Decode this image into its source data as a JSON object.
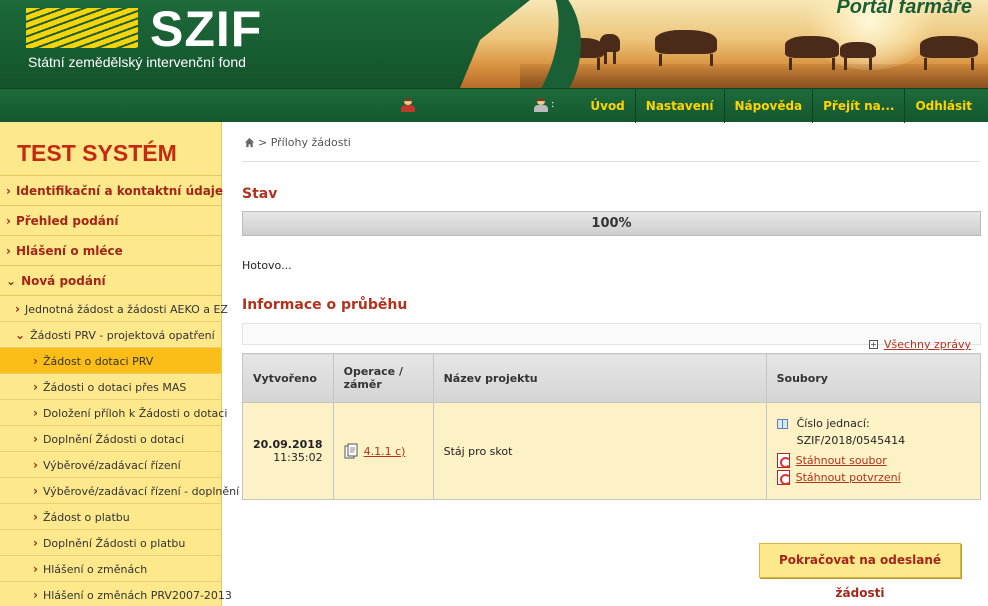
{
  "header": {
    "logo_text": "SZIF",
    "logo_subtitle": "Státní zemědělský intervenční fond",
    "portal_title": "Portál farmáře"
  },
  "nav": {
    "links": [
      "Úvod",
      "Nastavení",
      "Nápověda",
      "Přejít na...",
      "Odhlásit"
    ],
    "user_suffix": ":"
  },
  "sidebar": {
    "title": "TEST SYSTÉM",
    "items": [
      {
        "label": "Identifikační a kontaktní údaje",
        "level": 0
      },
      {
        "label": "Přehled podání",
        "level": 0
      },
      {
        "label": "Hlášení o mléce",
        "level": 0
      },
      {
        "label": "Nová podání",
        "level": 0,
        "expanded": true
      },
      {
        "label": "Jednotná žádost a žádosti AEKO a EZ",
        "level": 1
      },
      {
        "label": "Žádosti PRV - projektová opatření",
        "level": 1,
        "expanded": true
      },
      {
        "label": "Žádost o dotaci PRV",
        "level": 2,
        "active": true
      },
      {
        "label": "Žádosti o dotaci přes MAS",
        "level": 2
      },
      {
        "label": "Doložení příloh k Žádosti o dotaci",
        "level": 2
      },
      {
        "label": "Doplnění Žádosti o dotaci",
        "level": 2
      },
      {
        "label": "Výběrové/zadávací řízení",
        "level": 2
      },
      {
        "label": "Výběrové/zadávací řízení - doplnění",
        "level": 2
      },
      {
        "label": "Žádost o platbu",
        "level": 2
      },
      {
        "label": "Doplnění Žádosti o platbu",
        "level": 2
      },
      {
        "label": "Hlášení o změnách",
        "level": 2
      },
      {
        "label": "Hlášení o změnách PRV2007-2013",
        "level": 2
      }
    ]
  },
  "main": {
    "breadcrumb": "> Přílohy žádosti",
    "status_heading": "Stav",
    "progress_percent": 100,
    "progress_label": "100%",
    "status_text": "Hotovo...",
    "info_heading": "Informace o průběhu",
    "all_messages": "Všechny zprávy",
    "table": {
      "headers": [
        "Vytvořeno",
        "Operace / záměr",
        "Název projektu",
        "Soubory"
      ],
      "row": {
        "date": "20.09.2018",
        "time": "11:35:02",
        "operation": "4.1.1 c)",
        "project_name": "Stáj pro skot",
        "ref_label": "Číslo jednací:",
        "ref_number": "SZIF/2018/0545414",
        "download_file": "Stáhnout soubor",
        "download_confirmation": "Stáhnout potvrzení"
      }
    },
    "continue_button": "Pokračovat na odeslané žádosti"
  },
  "colors": {
    "header_green": "#1b5e35",
    "nav_link_yellow": "#ffd400",
    "sidebar_bg": "#fde88c",
    "sidebar_active": "#fbbd17",
    "accent_red": "#b2321e"
  }
}
